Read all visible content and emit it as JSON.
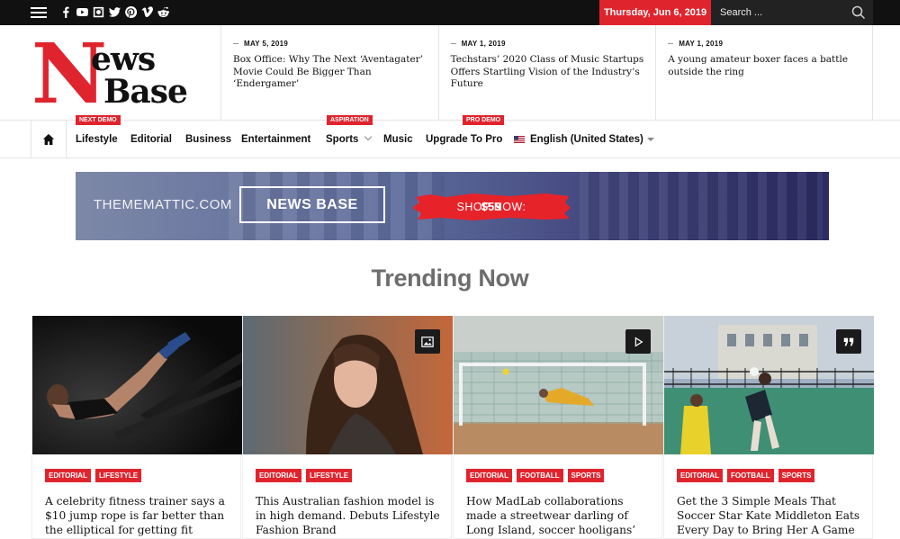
{
  "topbar": {
    "social_icons": [
      "facebook-icon",
      "youtube-icon",
      "instagram-icon",
      "twitter-icon",
      "pinterest-icon",
      "vimeo-icon",
      "reddit-icon"
    ],
    "date": "Thursday, Jun 6, 2019",
    "search_placeholder": "Search ..."
  },
  "logo": {
    "letter": "N",
    "line1": "ews",
    "line2": "Base"
  },
  "headlines": [
    {
      "date": "MAY 5, 2019",
      "title": "Box Office: Why The Next ‘Aventagater’ Movie Could Be Bigger Than ‘Endergamer’"
    },
    {
      "date": "MAY 1, 2019",
      "title": "Techstars’ 2020 Class of Music Startups Offers Startling Vision of the Industry’s Future"
    },
    {
      "date": "MAY 1, 2019",
      "title": "A young amateur boxer faces a battle outside the ring"
    }
  ],
  "nav": {
    "items": [
      {
        "label": "Lifestyle",
        "badge": "NEXT DEMO"
      },
      {
        "label": "Editorial",
        "badge": ""
      },
      {
        "label": "Business",
        "badge": ""
      },
      {
        "label": "Entertainment",
        "badge": ""
      },
      {
        "label": "Sports",
        "badge": "ASPIRATION"
      },
      {
        "label": "Music",
        "badge": ""
      },
      {
        "label": "Upgrade To Pro",
        "badge": "PRO DEMO"
      }
    ],
    "language": "English (United States)"
  },
  "banner": {
    "brand": "THEMEMATTIC.COM",
    "product": "NEWS BASE",
    "cta": "SHOP NOW:",
    "price": "$59"
  },
  "section_title": "Trending Now",
  "cards": [
    {
      "tags": [
        "EDITORIAL",
        "LIFESTYLE"
      ],
      "title": "A celebrity fitness trainer says a $10 jump rope is far better than the elliptical for getting fit",
      "media": ""
    },
    {
      "tags": [
        "EDITORIAL",
        "LIFESTYLE"
      ],
      "title": "This Australian fashion model is in high demand. Debuts Lifestyle Fashion Brand",
      "media": "gallery-icon"
    },
    {
      "tags": [
        "EDITORIAL",
        "FOOTBALL",
        "SPORTS"
      ],
      "title": "How MadLab collaborations made a streetwear darling of Long Island, soccer hooligans’ favourite",
      "media": "video-play-icon"
    },
    {
      "tags": [
        "EDITORIAL",
        "FOOTBALL",
        "SPORTS"
      ],
      "title": "Get the 3 Simple Meals That Soccer Star Kate Middleton Eats Every Day to Bring Her A Game",
      "media": "quote-icon"
    }
  ],
  "colors": {
    "accent": "#e0242d",
    "topbar": "#111111",
    "heading": "#6d6d6d"
  }
}
